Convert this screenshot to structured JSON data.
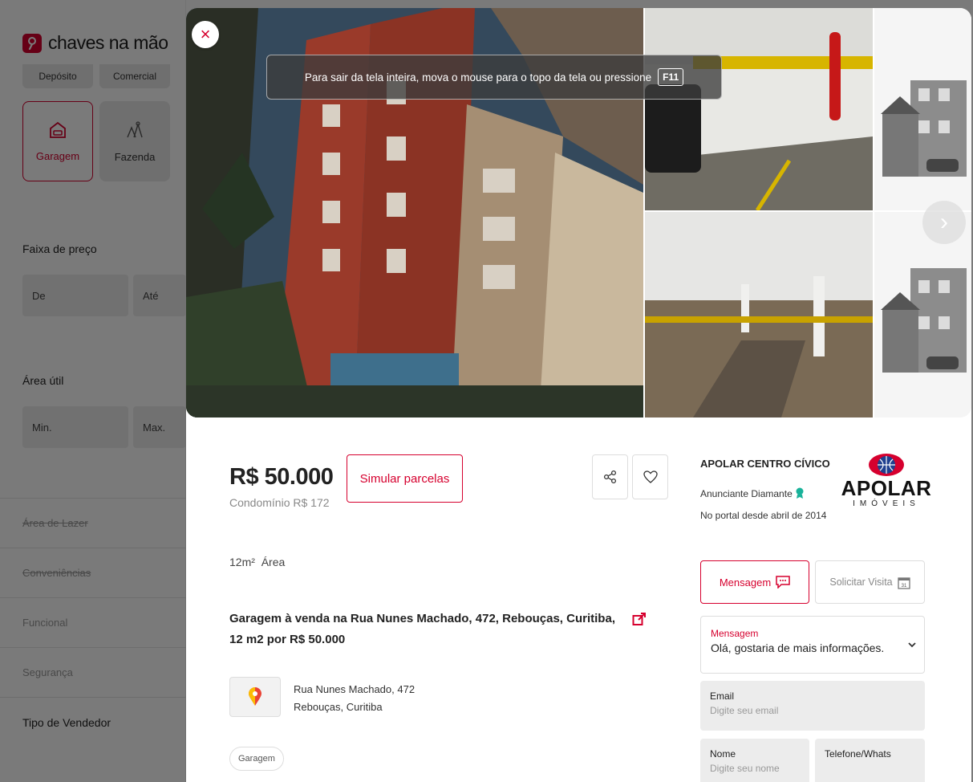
{
  "brand": {
    "name": "chaves na mão",
    "mark": "?"
  },
  "colors": {
    "accent": "#d6002e"
  },
  "sidebar": {
    "type_chips": [
      "Depósito",
      "Comercial"
    ],
    "type_cards": [
      {
        "label": "Garagem",
        "icon": "garage-icon",
        "active": true
      },
      {
        "label": "Fazenda",
        "icon": "farm-icon",
        "active": false
      }
    ],
    "price_label": "Faixa de preço",
    "price_from": "De",
    "price_to": "Até",
    "area_label": "Área útil",
    "area_min": "Min.",
    "area_max": "Max.",
    "sections": [
      "Área de Lazer",
      "Conveniências",
      "Funcional",
      "Segurança"
    ],
    "seller_label": "Tipo de Vendedor"
  },
  "viewer": {
    "close": "×",
    "fullscreen_notice": "Para sair da tela inteira, mova o mouse para o topo da tela ou pressione",
    "fullscreen_key": "F11",
    "next": "›"
  },
  "listing": {
    "price": "R$ 50.000",
    "condo": "Condomínio R$ 172",
    "simulate": "Simular parcelas",
    "area_value": "12m²",
    "area_label": "Área",
    "title": "Garagem à venda na Rua Nunes Machado, 472, Rebouças, Curitiba, 12 m2 por R$ 50.000",
    "street": "Rua Nunes Machado, 472",
    "district": "Rebouças, Curitiba",
    "tag": "Garagem"
  },
  "advertiser": {
    "name": "APOLAR CENTRO CÍVICO",
    "tier": "Anunciante Diamante",
    "since": "No portal desde abril de 2014",
    "logo_word": "APOLAR",
    "logo_sub": "IMÓVEIS"
  },
  "contact": {
    "tab_message": "Mensagem",
    "tab_visit": "Solicitar Visita",
    "message_label": "Mensagem",
    "message_value": "Olá, gostaria de mais informações.",
    "email_label": "Email",
    "email_placeholder": "Digite seu email",
    "name_label": "Nome",
    "name_placeholder": "Digite seu nome",
    "phone_label": "Telefone/Whats"
  }
}
